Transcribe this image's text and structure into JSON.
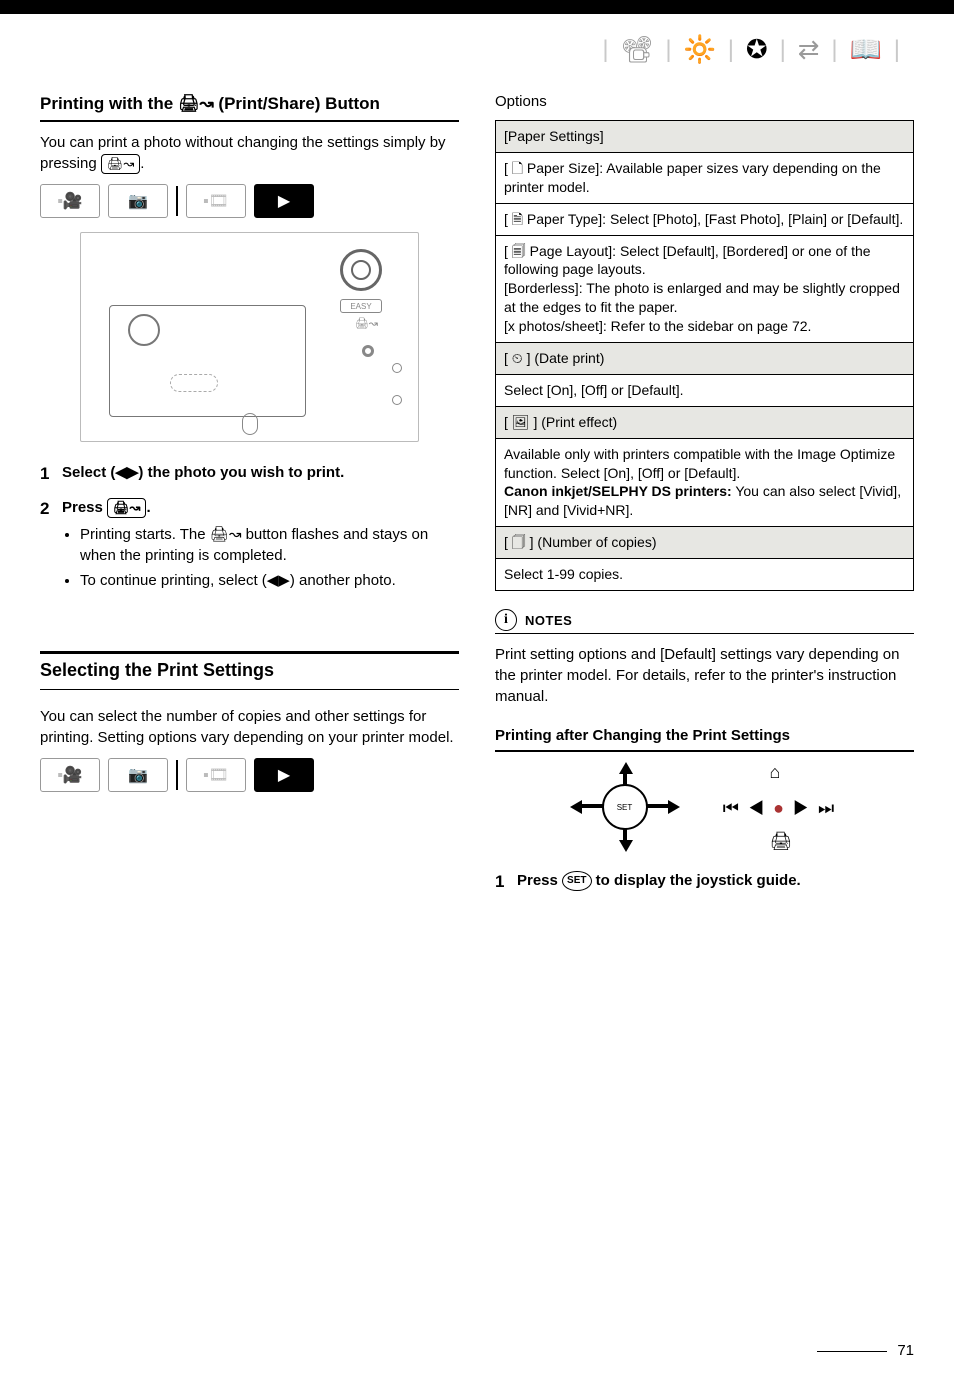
{
  "top_icons": {
    "i1": "📽",
    "i2": "🔆",
    "i3": "✪",
    "i4": "⇄",
    "i5": "📖"
  },
  "left": {
    "print_share_title": "Printing with the  🖨↝  (Print/Share) Button",
    "print_share_intro": "You can print a photo without changing the settings simply by pressing ",
    "key_print_share": "🖨↝",
    "mode": {
      "rec_v": "▪🎥",
      "rec_p": "📷",
      "play_v": "▪🎞",
      "play_p": "▶"
    },
    "step1": "Select (◀▶) the photo you wish to print.",
    "step2_head": "Press ",
    "step2_b1a": "Printing starts. The ",
    "step2_b1b": " button flashes and stays on when the printing is completed.",
    "step2_b2": "To continue printing, select (◀▶) another photo.",
    "select_settings_h": "Selecting the Print Settings",
    "select_settings_body": "You can select the number of copies and other settings for printing. Setting options vary depending on your printer model."
  },
  "right": {
    "options": "Options",
    "table": {
      "paper_settings": "[Paper Settings]",
      "paper_size": "[ 🗋 Paper Size]: Available paper sizes vary depending on the printer model.",
      "paper_type": "[ 🗎 Paper Type]: Select [Photo], [Fast Photo], [Plain] or [Default].",
      "page_layout": "[ 🗐 Page Layout]: Select [Default], [Bordered] or one of the following page layouts.\n[Borderless]: The photo is enlarged and may be slightly cropped at the edges to fit the paper.\n[x photos/sheet]: Refer to the sidebar on page 72.",
      "date_print_h": "[ ⏲ ] (Date print)",
      "date_print_b": "Select [On], [Off] or [Default].",
      "print_effect_h": "[ 🖼 ] (Print effect)",
      "print_effect_b1": "Available only with printers compatible with the Image Optimize function. Select [On], [Off] or [Default].",
      "print_effect_strong": "Canon inkjet/SELPHY DS printers:",
      "print_effect_b2": " You can also select [Vivid], [NR] and [Vivid+NR].",
      "copies_h": "[ 🗍 ] (Number of copies)",
      "copies_b": "Select 1-99 copies."
    },
    "notes_label": "NOTES",
    "notes_body": "Print setting options and [Default] settings vary depending on the printer model. For details, refer to the printer's instruction manual.",
    "after_change_h": "Printing after Changing the Print Settings",
    "joy": {
      "ret": "⌂",
      "mid_l": "⏮ ◀",
      "mid_r": "▶ ⏭",
      "dot": "●",
      "pr": "🖨"
    },
    "step1a": "Press ",
    "step1_set": "SET",
    "step1b": " to display the joystick guide."
  },
  "page_number": "71"
}
